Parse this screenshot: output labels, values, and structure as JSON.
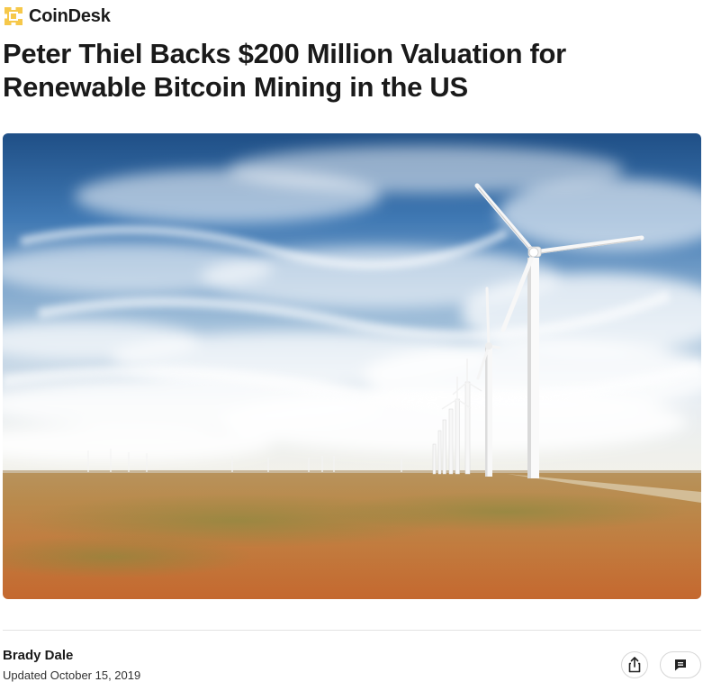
{
  "brand": {
    "name": "CoinDesk",
    "logo_icon": "coindesk-logo-icon",
    "accent_color": "#F6C84A"
  },
  "article": {
    "headline": "Peter Thiel Backs $200 Million Valuation for Renewable Bitcoin Mining in the US",
    "hero_image": "wind-farm-photo",
    "author": "Brady Dale",
    "updated": "Updated October 15, 2019"
  },
  "actions": {
    "share_icon": "share-icon",
    "comment_icon": "comment-icon"
  }
}
